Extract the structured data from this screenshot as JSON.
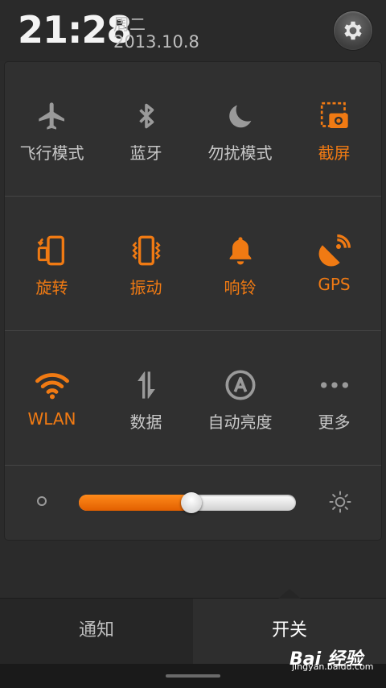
{
  "status": {
    "time": "21:28",
    "weekday": "周二",
    "date": "2013.10.8"
  },
  "settings": {
    "icon": "gear-icon"
  },
  "colors": {
    "accent": "#f07a13",
    "inactive": "#c8c8c8",
    "panel": "#303030"
  },
  "toggles": {
    "row1": [
      {
        "label": "飞行模式",
        "icon": "airplane-icon",
        "state": "off"
      },
      {
        "label": "蓝牙",
        "icon": "bluetooth-icon",
        "state": "off"
      },
      {
        "label": "勿扰模式",
        "icon": "moon-icon",
        "state": "off"
      },
      {
        "label": "截屏",
        "icon": "screenshot-icon",
        "state": "on"
      }
    ],
    "row2": [
      {
        "label": "旋转",
        "icon": "rotate-icon",
        "state": "on"
      },
      {
        "label": "振动",
        "icon": "vibrate-icon",
        "state": "on"
      },
      {
        "label": "响铃",
        "icon": "bell-icon",
        "state": "on"
      },
      {
        "label": "GPS",
        "icon": "gps-icon",
        "state": "on"
      }
    ],
    "row3": [
      {
        "label": "WLAN",
        "icon": "wifi-icon",
        "state": "on"
      },
      {
        "label": "数据",
        "icon": "data-icon",
        "state": "off"
      },
      {
        "label": "自动亮度",
        "icon": "auto-brightness-icon",
        "state": "off"
      },
      {
        "label": "更多",
        "icon": "more-icon",
        "state": "off"
      }
    ]
  },
  "brightness": {
    "level": 0.52
  },
  "tabs": {
    "notify": "通知",
    "toggles": "开关",
    "active": "toggles"
  },
  "watermark": {
    "text": "Bai 经验",
    "sub": "jingyan.baidu.com"
  }
}
